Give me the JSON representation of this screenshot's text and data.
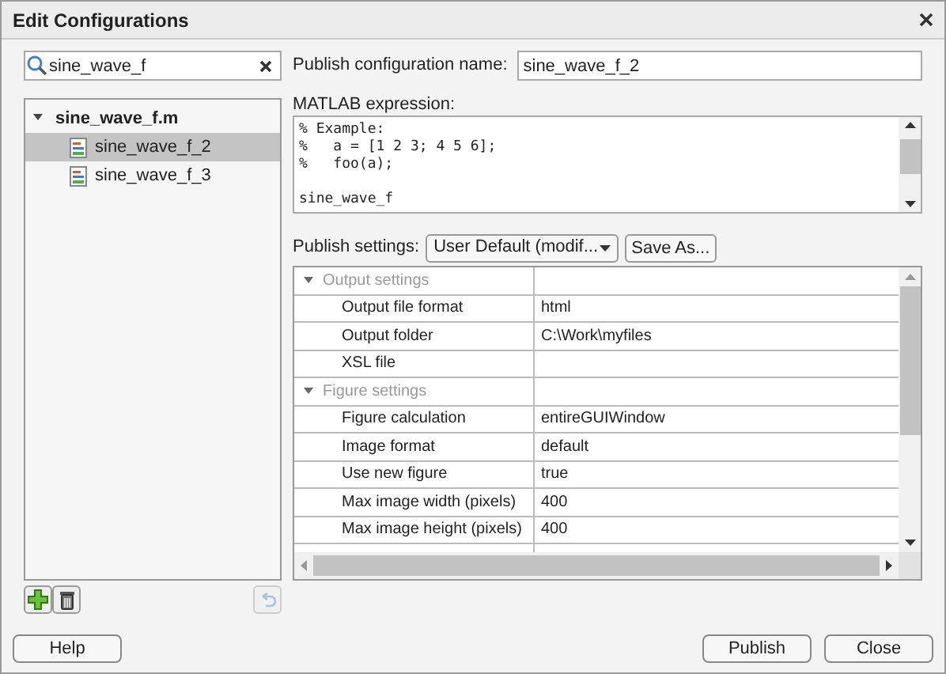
{
  "window": {
    "title": "Edit Configurations"
  },
  "search": {
    "value": "sine_wave_f"
  },
  "tree": [
    {
      "label": "sine_wave_f.m",
      "expanded": true,
      "children": [
        {
          "label": "sine_wave_f_2",
          "selected": true
        },
        {
          "label": "sine_wave_f_3",
          "selected": false
        }
      ]
    }
  ],
  "config_name": {
    "label": "Publish configuration name:",
    "value": "sine_wave_f_2"
  },
  "expression": {
    "label": "MATLAB expression:",
    "code": "% Example:\n%   a = [1 2 3; 4 5 6];\n%   foo(a);\n\nsine_wave_f"
  },
  "publish_settings": {
    "label": "Publish settings:",
    "dropdown": "User Default (modif...",
    "save_as": "Save As..."
  },
  "settings": [
    {
      "kind": "group",
      "label": "Output settings",
      "expanded": true
    },
    {
      "kind": "setting",
      "label": "Output file format",
      "value": "html"
    },
    {
      "kind": "setting",
      "label": "Output folder",
      "value": "C:\\Work\\myfiles"
    },
    {
      "kind": "setting",
      "label": "XSL file"
    },
    {
      "kind": "group",
      "label": "Figure settings",
      "expanded": true
    },
    {
      "kind": "setting",
      "label": "Figure calculation",
      "value": "entireGUIWindow"
    },
    {
      "kind": "setting",
      "label": "Image format",
      "value": "default"
    },
    {
      "kind": "setting",
      "label": "Use new figure",
      "value": "true"
    },
    {
      "kind": "setting",
      "label": "Max image width (pixels)",
      "value": "400"
    },
    {
      "kind": "setting",
      "label": "Max image height (pixels)",
      "value": "400"
    }
  ],
  "buttons": {
    "help": "Help",
    "publish": "Publish",
    "close": "Close"
  }
}
